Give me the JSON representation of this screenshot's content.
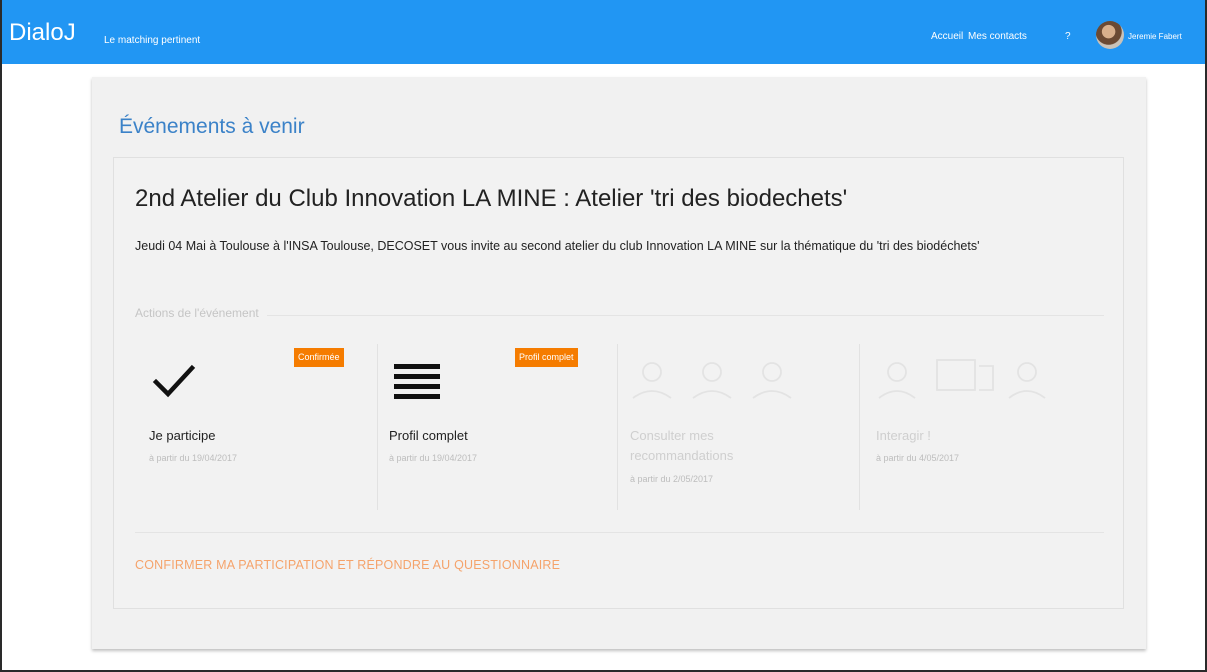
{
  "navbar": {
    "brand": "DialoJ",
    "tagline": "Le matching pertinent",
    "links": [
      "Accueil",
      "Mes contacts",
      "?"
    ],
    "user_name": "Jeremie Fabert",
    "color": "#2196f3"
  },
  "main": {
    "title": "Événements à venir",
    "event": {
      "title": "2nd Atelier du Club Innovation LA MINE : Atelier 'tri des biodechets'",
      "description": "Jeudi 04 Mai à Toulouse à l'INSA Toulouse, DECOSET vous invite au second atelier du club Innovation LA MINE sur la thématique du 'tri des biodéchets'",
      "actions_label": "Actions de l'événement",
      "steps": [
        {
          "label": "Je participe",
          "date": "à partir du 19/04/2017",
          "badge": "Confirmée",
          "icon": "check-icon"
        },
        {
          "label": "Profil complet",
          "date": "à partir du 19/04/2017",
          "badge": "Profil complet",
          "icon": "menu-lines-icon"
        },
        {
          "label": "Consulter mes recommandations",
          "date": "à partir du 2/05/2017",
          "icon": "people-icon"
        },
        {
          "label": "Interagir !",
          "date": "à partir du 4/05/2017",
          "icon": "people-chat-icon"
        }
      ],
      "cta": "CONFIRMER MA PARTICIPATION ET RÉPONDRE AU QUESTIONNAIRE"
    }
  }
}
